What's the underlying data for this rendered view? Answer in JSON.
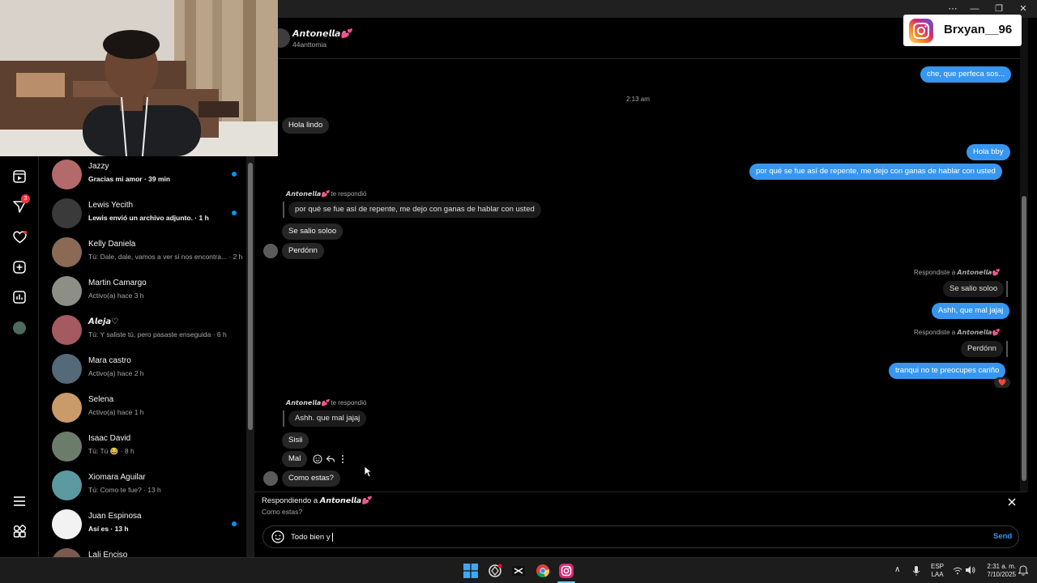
{
  "window": {
    "minimize": "—",
    "restore": "❐",
    "close": "✕",
    "more": "⋯"
  },
  "overlay": {
    "instagram_handle": "Brxyan__96"
  },
  "chat": {
    "contact_name": "𝘼𝙣𝙩𝙤𝙣𝙚𝙡𝙡𝙖💕",
    "contact_username": "44anttomia",
    "timestamp": "2:13 am",
    "messages": {
      "m_che": "che, que perfeca sos...",
      "m_hola_lindo": "Hola lindo",
      "m_hola_bby": "Hola bby",
      "m_porque_out": "por qué se fue así de repente, me dejo con ganas de hablar con usted",
      "reply_meta_1_name": "𝘼𝙣𝙩𝙤𝙣𝙚𝙡𝙡𝙖💕",
      "reply_meta_1_suffix": " te respondió",
      "m_porque_quote": "por qué se fue así de repente, me dejo con ganas de hablar con usted",
      "m_se_salio": "Se salio soloo",
      "m_perdonn": "Perdónn",
      "reply_meta_2": "Respondiste a 𝘼𝙣𝙩𝙤𝙣𝙚𝙡𝙡𝙖💕",
      "m_se_salio_quote": "Se salio soloo",
      "m_ashh_out": "Ashh, que mal jajaj",
      "reply_meta_3": "Respondiste a 𝘼𝙣𝙩𝙤𝙣𝙚𝙡𝙡𝙖💕",
      "m_perdonn_quote": "Perdónn",
      "m_tranqui": "tranqui no te preocupes cariño",
      "reaction": "❤️",
      "reply_meta_4_name": "𝘼𝙣𝙩𝙤𝙣𝙚𝙡𝙡𝙖💕",
      "reply_meta_4_suffix": " te respondió",
      "m_ashh_quote": "Ashh. que mal jajaj",
      "m_sisii": "Sisii",
      "m_mal": "Mal",
      "m_como_estas": "Como estas?"
    },
    "replying_to_label": "Respondiendo a ",
    "replying_to_name": "𝘼𝙣𝙩𝙤𝙣𝙚𝙡𝙡𝙖💕",
    "replying_to_text": "Como estas?",
    "input_value": "Todo bien y",
    "send_label": "Send"
  },
  "conversations": [
    {
      "name": "Jazzy",
      "preview": "Gracias mi amor · 39 min",
      "unread": true
    },
    {
      "name": "Lewis Yecith",
      "preview": "Lewis envió un archivo adjunto. · 1 h",
      "unread": true
    },
    {
      "name": "Kelly Daniela",
      "preview": "Tú: Dale, dale, vamos a ver si nos encontra... · 2 h",
      "unread": false
    },
    {
      "name": "Martin Camargo",
      "preview": "Activo(a) hace 3 h",
      "unread": false
    },
    {
      "name": "𝘼𝙡𝙚𝙟𝙖♡",
      "preview": "Tú: Y saliste tú, pero pasaste enseguida · 6 h",
      "unread": false
    },
    {
      "name": "Mara castro",
      "preview": "Activo(a) hace 2 h",
      "unread": false
    },
    {
      "name": "Selena",
      "preview": "Activo(a) hace 1 h",
      "unread": false
    },
    {
      "name": "Isaac David",
      "preview": "Tú: Tú 😂 · 8 h",
      "unread": false
    },
    {
      "name": "Xiomara Aguilar",
      "preview": "Tú: Como te fue? · 13 h",
      "unread": false
    },
    {
      "name": "Juan Espinosa",
      "preview": "Así es · 13 h",
      "unread": true
    },
    {
      "name": "Lali Enciso",
      "preview": "",
      "unread": false
    }
  ],
  "rail": {
    "notif_badge": "3"
  },
  "taskbar": {
    "lang_top": "ESP",
    "lang_bottom": "LAA",
    "time": "2:31 a. m.",
    "date": "7/10/2025",
    "chevron": "∧"
  },
  "colors": {
    "accent": "#3797f0",
    "unread_dot": "#0095f6",
    "background": "#000000"
  }
}
